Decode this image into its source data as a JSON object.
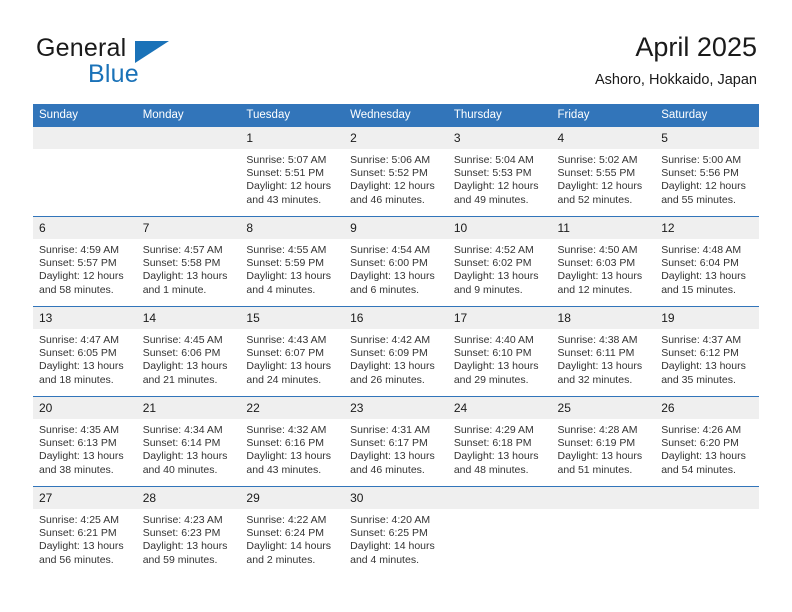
{
  "brand": {
    "word1": "General",
    "word2": "Blue",
    "triangle_icon": "triangle-icon",
    "accent_color": "#1a72b8"
  },
  "header": {
    "title": "April 2025",
    "subtitle": "Ashoro, Hokkaido, Japan"
  },
  "calendar": {
    "header_bg": "#3275ba",
    "daynum_bg": "#efefef",
    "weekday_headers": [
      "Sunday",
      "Monday",
      "Tuesday",
      "Wednesday",
      "Thursday",
      "Friday",
      "Saturday"
    ],
    "weeks": [
      [
        {
          "day": "",
          "blank": true
        },
        {
          "day": "",
          "blank": true
        },
        {
          "day": "1",
          "sunrise": "Sunrise: 5:07 AM",
          "sunset": "Sunset: 5:51 PM",
          "daylight": "Daylight: 12 hours and 43 minutes."
        },
        {
          "day": "2",
          "sunrise": "Sunrise: 5:06 AM",
          "sunset": "Sunset: 5:52 PM",
          "daylight": "Daylight: 12 hours and 46 minutes."
        },
        {
          "day": "3",
          "sunrise": "Sunrise: 5:04 AM",
          "sunset": "Sunset: 5:53 PM",
          "daylight": "Daylight: 12 hours and 49 minutes."
        },
        {
          "day": "4",
          "sunrise": "Sunrise: 5:02 AM",
          "sunset": "Sunset: 5:55 PM",
          "daylight": "Daylight: 12 hours and 52 minutes."
        },
        {
          "day": "5",
          "sunrise": "Sunrise: 5:00 AM",
          "sunset": "Sunset: 5:56 PM",
          "daylight": "Daylight: 12 hours and 55 minutes."
        }
      ],
      [
        {
          "day": "6",
          "sunrise": "Sunrise: 4:59 AM",
          "sunset": "Sunset: 5:57 PM",
          "daylight": "Daylight: 12 hours and 58 minutes."
        },
        {
          "day": "7",
          "sunrise": "Sunrise: 4:57 AM",
          "sunset": "Sunset: 5:58 PM",
          "daylight": "Daylight: 13 hours and 1 minute."
        },
        {
          "day": "8",
          "sunrise": "Sunrise: 4:55 AM",
          "sunset": "Sunset: 5:59 PM",
          "daylight": "Daylight: 13 hours and 4 minutes."
        },
        {
          "day": "9",
          "sunrise": "Sunrise: 4:54 AM",
          "sunset": "Sunset: 6:00 PM",
          "daylight": "Daylight: 13 hours and 6 minutes."
        },
        {
          "day": "10",
          "sunrise": "Sunrise: 4:52 AM",
          "sunset": "Sunset: 6:02 PM",
          "daylight": "Daylight: 13 hours and 9 minutes."
        },
        {
          "day": "11",
          "sunrise": "Sunrise: 4:50 AM",
          "sunset": "Sunset: 6:03 PM",
          "daylight": "Daylight: 13 hours and 12 minutes."
        },
        {
          "day": "12",
          "sunrise": "Sunrise: 4:48 AM",
          "sunset": "Sunset: 6:04 PM",
          "daylight": "Daylight: 13 hours and 15 minutes."
        }
      ],
      [
        {
          "day": "13",
          "sunrise": "Sunrise: 4:47 AM",
          "sunset": "Sunset: 6:05 PM",
          "daylight": "Daylight: 13 hours and 18 minutes."
        },
        {
          "day": "14",
          "sunrise": "Sunrise: 4:45 AM",
          "sunset": "Sunset: 6:06 PM",
          "daylight": "Daylight: 13 hours and 21 minutes."
        },
        {
          "day": "15",
          "sunrise": "Sunrise: 4:43 AM",
          "sunset": "Sunset: 6:07 PM",
          "daylight": "Daylight: 13 hours and 24 minutes."
        },
        {
          "day": "16",
          "sunrise": "Sunrise: 4:42 AM",
          "sunset": "Sunset: 6:09 PM",
          "daylight": "Daylight: 13 hours and 26 minutes."
        },
        {
          "day": "17",
          "sunrise": "Sunrise: 4:40 AM",
          "sunset": "Sunset: 6:10 PM",
          "daylight": "Daylight: 13 hours and 29 minutes."
        },
        {
          "day": "18",
          "sunrise": "Sunrise: 4:38 AM",
          "sunset": "Sunset: 6:11 PM",
          "daylight": "Daylight: 13 hours and 32 minutes."
        },
        {
          "day": "19",
          "sunrise": "Sunrise: 4:37 AM",
          "sunset": "Sunset: 6:12 PM",
          "daylight": "Daylight: 13 hours and 35 minutes."
        }
      ],
      [
        {
          "day": "20",
          "sunrise": "Sunrise: 4:35 AM",
          "sunset": "Sunset: 6:13 PM",
          "daylight": "Daylight: 13 hours and 38 minutes."
        },
        {
          "day": "21",
          "sunrise": "Sunrise: 4:34 AM",
          "sunset": "Sunset: 6:14 PM",
          "daylight": "Daylight: 13 hours and 40 minutes."
        },
        {
          "day": "22",
          "sunrise": "Sunrise: 4:32 AM",
          "sunset": "Sunset: 6:16 PM",
          "daylight": "Daylight: 13 hours and 43 minutes."
        },
        {
          "day": "23",
          "sunrise": "Sunrise: 4:31 AM",
          "sunset": "Sunset: 6:17 PM",
          "daylight": "Daylight: 13 hours and 46 minutes."
        },
        {
          "day": "24",
          "sunrise": "Sunrise: 4:29 AM",
          "sunset": "Sunset: 6:18 PM",
          "daylight": "Daylight: 13 hours and 48 minutes."
        },
        {
          "day": "25",
          "sunrise": "Sunrise: 4:28 AM",
          "sunset": "Sunset: 6:19 PM",
          "daylight": "Daylight: 13 hours and 51 minutes."
        },
        {
          "day": "26",
          "sunrise": "Sunrise: 4:26 AM",
          "sunset": "Sunset: 6:20 PM",
          "daylight": "Daylight: 13 hours and 54 minutes."
        }
      ],
      [
        {
          "day": "27",
          "sunrise": "Sunrise: 4:25 AM",
          "sunset": "Sunset: 6:21 PM",
          "daylight": "Daylight: 13 hours and 56 minutes."
        },
        {
          "day": "28",
          "sunrise": "Sunrise: 4:23 AM",
          "sunset": "Sunset: 6:23 PM",
          "daylight": "Daylight: 13 hours and 59 minutes."
        },
        {
          "day": "29",
          "sunrise": "Sunrise: 4:22 AM",
          "sunset": "Sunset: 6:24 PM",
          "daylight": "Daylight: 14 hours and 2 minutes."
        },
        {
          "day": "30",
          "sunrise": "Sunrise: 4:20 AM",
          "sunset": "Sunset: 6:25 PM",
          "daylight": "Daylight: 14 hours and 4 minutes."
        },
        {
          "day": "",
          "blank": true
        },
        {
          "day": "",
          "blank": true
        },
        {
          "day": "",
          "blank": true
        }
      ]
    ]
  }
}
